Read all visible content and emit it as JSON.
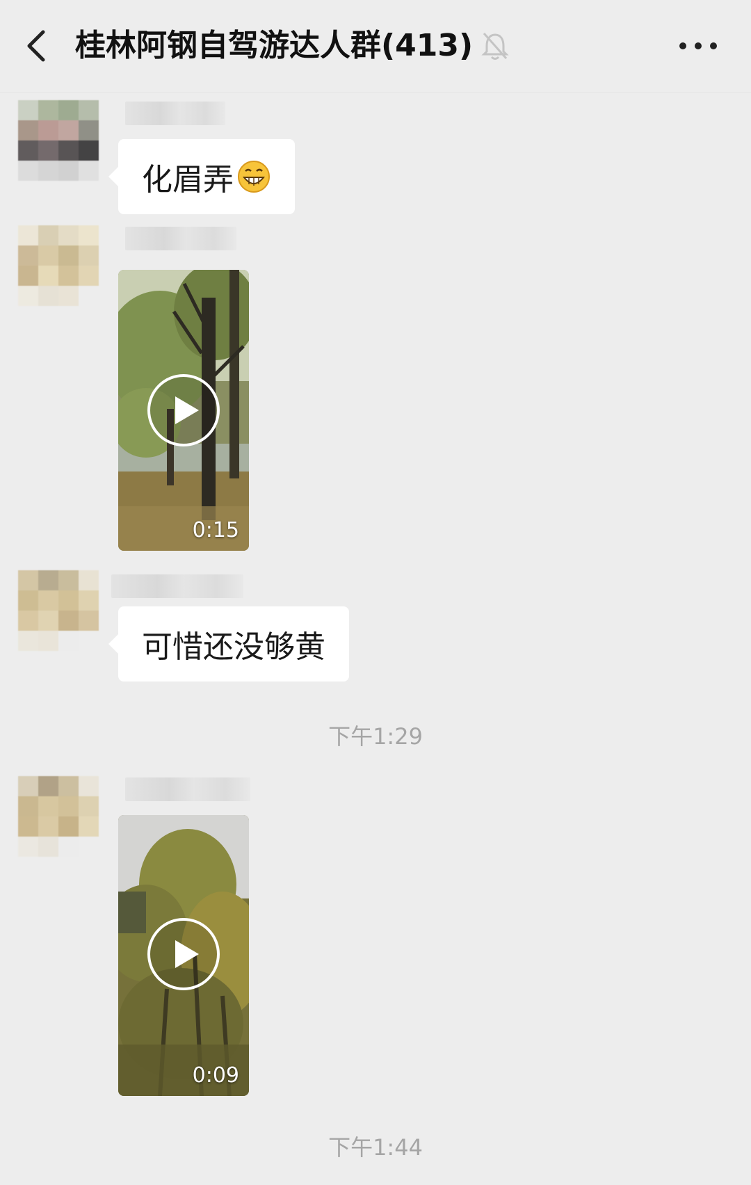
{
  "header": {
    "title": "桂林阿钢自驾游达人群(413)",
    "back_icon": "chevron-left-icon",
    "mute_icon": "bell-off-icon",
    "more_icon": "more-dots-icon"
  },
  "messages": [
    {
      "type": "text",
      "text": "化眉弄",
      "emoji": "grinning-face-emoji"
    },
    {
      "type": "video",
      "duration": "0:15",
      "icon": "play-icon"
    },
    {
      "type": "text",
      "text": "可惜还没够黄"
    },
    {
      "type": "time",
      "text": "下午1:29"
    },
    {
      "type": "video",
      "duration": "0:09",
      "icon": "play-icon"
    },
    {
      "type": "time",
      "text": "下午1:44"
    }
  ],
  "colors": {
    "background": "#ededed",
    "bubble": "#ffffff",
    "timestamp": "#a5a5a5"
  }
}
